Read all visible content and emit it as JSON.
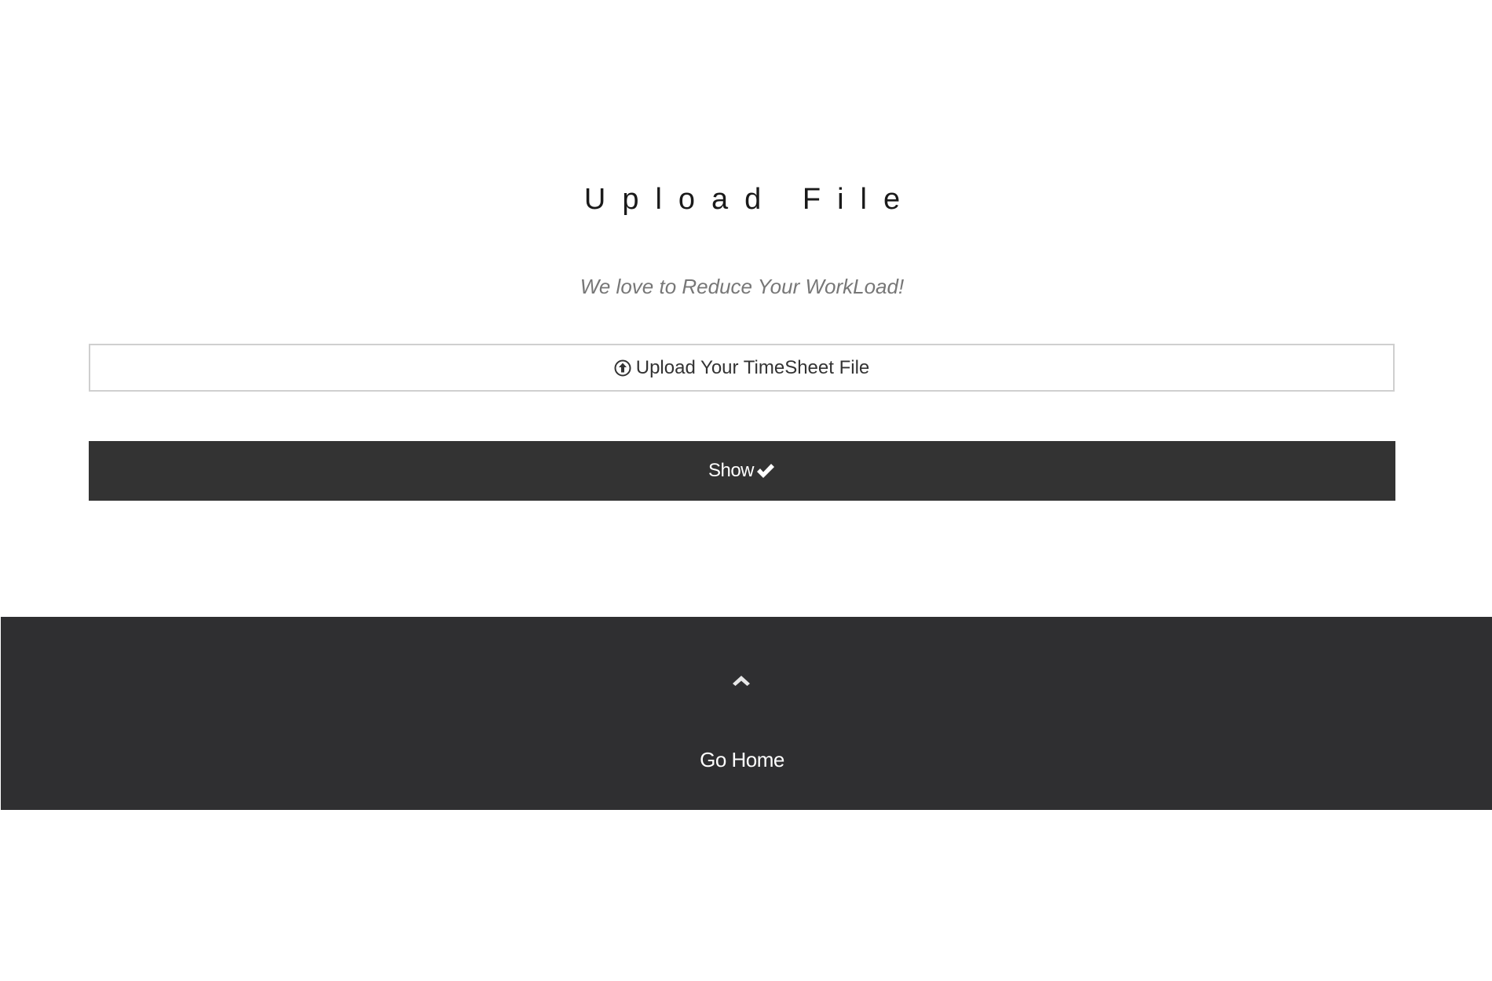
{
  "header": {
    "title": "Upload File",
    "tagline": "We love to Reduce Your WorkLoad!"
  },
  "form": {
    "upload_label": "Upload Your TimeSheet File",
    "upload_icon": "upload-circle-icon",
    "show_label": "Show",
    "show_icon": "check-icon"
  },
  "footer": {
    "up_icon": "chevron-up-icon",
    "home_label": "Go Home"
  },
  "colors": {
    "dark": "#333333",
    "footer_bg": "#2f2f31",
    "tagline": "#777777",
    "border": "#cfcfcf"
  }
}
